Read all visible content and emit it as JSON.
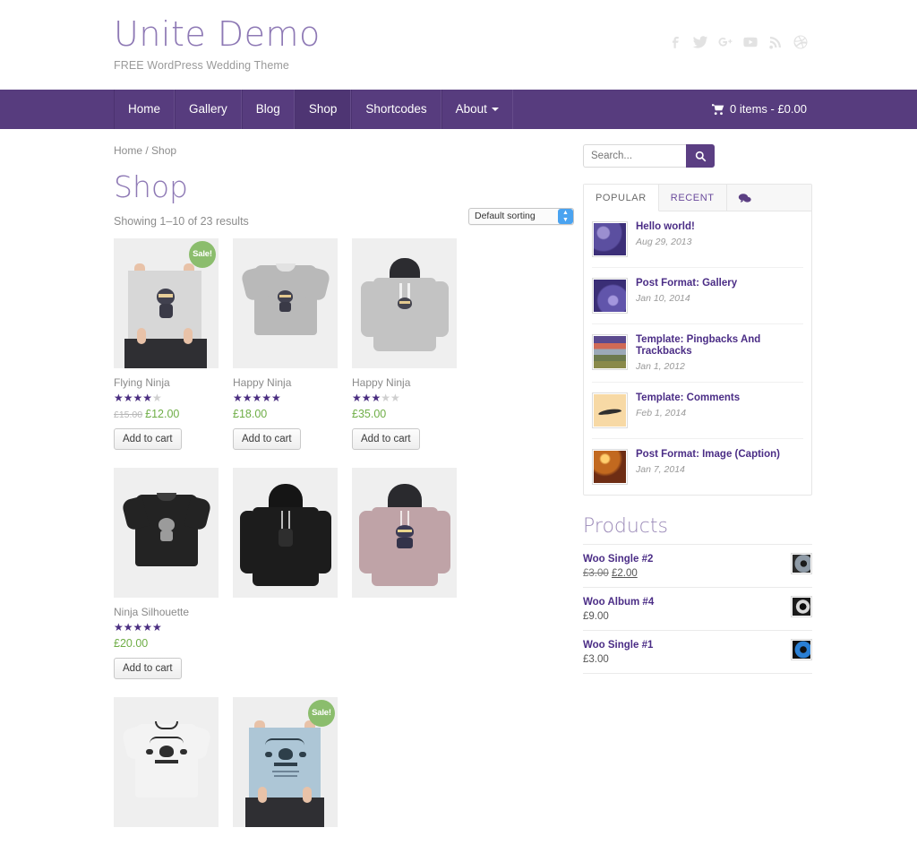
{
  "site": {
    "title": "Unite Demo",
    "tagline": "FREE WordPress Wedding Theme"
  },
  "social": [
    {
      "name": "facebook-icon",
      "label": "f"
    },
    {
      "name": "twitter-icon",
      "label": "t"
    },
    {
      "name": "google-plus-icon",
      "label": "g+"
    },
    {
      "name": "youtube-icon",
      "label": "yt"
    },
    {
      "name": "rss-icon",
      "label": "rss"
    },
    {
      "name": "dribbble-icon",
      "label": "dribbble"
    }
  ],
  "nav": {
    "items": [
      {
        "label": "Home",
        "active": false,
        "dropdown": false
      },
      {
        "label": "Gallery",
        "active": false,
        "dropdown": false
      },
      {
        "label": "Blog",
        "active": false,
        "dropdown": false
      },
      {
        "label": "Shop",
        "active": true,
        "dropdown": false
      },
      {
        "label": "Shortcodes",
        "active": false,
        "dropdown": false
      },
      {
        "label": "About",
        "active": false,
        "dropdown": true
      }
    ],
    "cart_label": "0 items - £0.00"
  },
  "main": {
    "breadcrumb": "Home / Shop",
    "page_title": "Shop",
    "result_count": "Showing 1–10 of 23 results",
    "sorting_selected": "Default sorting",
    "add_to_cart_label": "Add to cart",
    "sale_label": "Sale!",
    "products": [
      {
        "name": "Flying Ninja",
        "rating": 4,
        "price": "£12.00",
        "old_price": "£15.00",
        "on_sale": true,
        "art": "poster-ninja"
      },
      {
        "name": "Happy Ninja",
        "rating": 5,
        "price": "£18.00",
        "old_price": "",
        "on_sale": false,
        "art": "tee-grey"
      },
      {
        "name": "Happy Ninja",
        "rating": 3,
        "price": "£35.00",
        "old_price": "",
        "on_sale": false,
        "art": "hoodie-grey"
      },
      {
        "name": "Ninja Silhouette",
        "rating": 5,
        "price": "£20.00",
        "old_price": "",
        "on_sale": false,
        "art": "tee-black"
      },
      {
        "name": "",
        "rating": 0,
        "price": "",
        "old_price": "",
        "on_sale": false,
        "art": "hoodie-black"
      },
      {
        "name": "",
        "rating": 0,
        "price": "",
        "old_price": "",
        "on_sale": false,
        "art": "hoodie-pink"
      },
      {
        "name": "",
        "rating": 0,
        "price": "",
        "old_price": "",
        "on_sale": false,
        "art": "tee-white"
      },
      {
        "name": "",
        "rating": 0,
        "price": "",
        "old_price": "",
        "on_sale": true,
        "art": "poster-blue"
      }
    ]
  },
  "sidebar": {
    "search_placeholder": "Search...",
    "search_value": "",
    "tabs": [
      {
        "label": "POPULAR",
        "active": true
      },
      {
        "label": "RECENT",
        "active": false
      },
      {
        "label": "💬",
        "active": false,
        "icon": "comments-icon"
      }
    ],
    "posts": [
      {
        "title": "Hello world!",
        "date": "Aug 29, 2013",
        "thumb": "purple-bokeh"
      },
      {
        "title": "Post Format: Gallery",
        "date": "Jan 10, 2014",
        "thumb": "purple-bokeh"
      },
      {
        "title": "Template: Pingbacks And Trackbacks",
        "date": "Jan 1, 2012",
        "thumb": "sunset-field"
      },
      {
        "title": "Template: Comments",
        "date": "Feb 1, 2014",
        "thumb": "cream-bird"
      },
      {
        "title": "Post Format: Image (Caption)",
        "date": "Jan 7, 2014",
        "thumb": "orange-lights"
      }
    ],
    "products_widget_title": "Products",
    "products": [
      {
        "name": "Woo Single #2",
        "old_price": "£3.00",
        "price": "£2.00",
        "thumb": "vinyl-grey"
      },
      {
        "name": "Woo Album #4",
        "old_price": "",
        "price": "£9.00",
        "thumb": "vinyl-dark"
      },
      {
        "name": "Woo Single #1",
        "old_price": "",
        "price": "£3.00",
        "thumb": "vinyl-blue"
      }
    ]
  },
  "colors": {
    "nav_purple": "#573c7e",
    "brand_purple": "#8e79b5",
    "link_purple": "#4b2d86",
    "price_green": "#6fae47",
    "sale_green": "#8bbd6d",
    "star_purple": "#4a2d80"
  }
}
